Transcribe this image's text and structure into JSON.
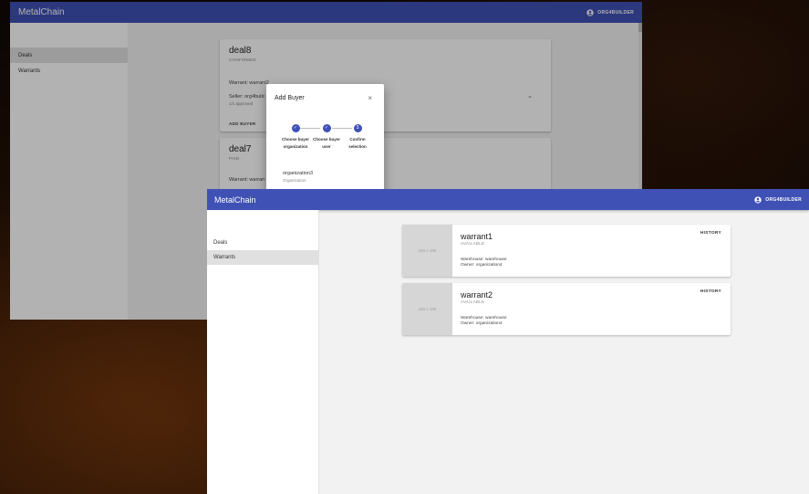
{
  "back_window": {
    "app_title": "MetalChain",
    "user": "ORG4BUILDER",
    "sidebar": {
      "items": [
        {
          "label": "Deals",
          "active": true
        },
        {
          "label": "Warrants",
          "active": false
        }
      ]
    },
    "deals": [
      {
        "title": "deal8",
        "status": "CONFIRMED",
        "warrant": "Warrant: warrant2",
        "seller": "Seller: org4builc",
        "approved": "1/1 approved",
        "action": "ADD BUYER"
      },
      {
        "title": "deal7",
        "status": "PAID",
        "warrant": "Warrant: warran"
      }
    ],
    "dialog": {
      "title": "Add Buyer",
      "close_glyph": "×",
      "steps": [
        {
          "label": "Choose buyer organization",
          "state": "done",
          "glyph": "✓"
        },
        {
          "label": "Choose buyer user",
          "state": "done",
          "glyph": "✓"
        },
        {
          "label": "Confirm selection",
          "state": "active",
          "glyph": "3"
        }
      ],
      "option": {
        "name": "organization3",
        "type": "Organization"
      }
    }
  },
  "front_window": {
    "app_title": "MetalChain",
    "user": "ORG4BUILDER",
    "sidebar": {
      "items": [
        {
          "label": "Deals",
          "active": false
        },
        {
          "label": "Warrants",
          "active": true
        }
      ]
    },
    "warrants": [
      {
        "thumb": "180 x 180",
        "name": "warrant1",
        "status": "AVAILABLE",
        "warehouse": "Warehouse: warehouse",
        "owner": "Owner: organization4",
        "history": "HISTORY"
      },
      {
        "thumb": "180 x 180",
        "name": "warrant2",
        "status": "AVAILABLE",
        "warehouse": "Warehouse: warehouse",
        "owner": "Owner: organization4",
        "history": "HISTORY"
      }
    ]
  },
  "colors": {
    "appbar": "#3f51b5",
    "active_item": "#e0e0e0",
    "content_bg": "#f2f2f2"
  },
  "icons": [
    "account-circle-icon",
    "close-icon",
    "check-icon",
    "chevron-down-icon"
  ]
}
